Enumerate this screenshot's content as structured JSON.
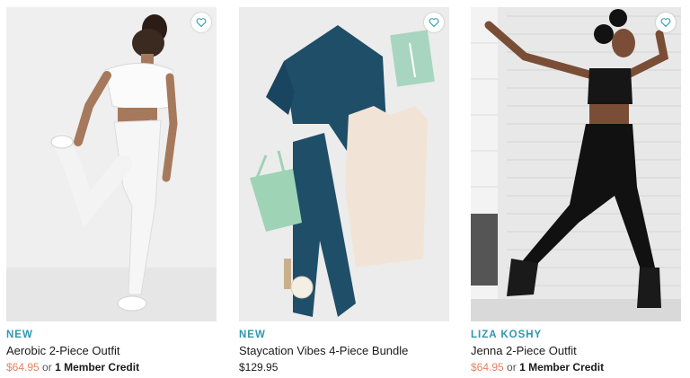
{
  "products": [
    {
      "badge": "NEW",
      "name": "Aerobic 2-Piece Outfit",
      "price": "$64.95",
      "price_color": "#e8825e",
      "or_text": "or",
      "credit_text": "1 Member Credit",
      "favorite_icon": "heart-outline-icon"
    },
    {
      "badge": "NEW",
      "name": "Staycation Vibes 4-Piece Bundle",
      "price": "$129.95",
      "price_color": "#1a1a1a",
      "favorite_icon": "heart-outline-icon"
    },
    {
      "badge": "LIZA KOSHY",
      "name": "Jenna 2-Piece Outfit",
      "price": "$64.95",
      "price_color": "#e8825e",
      "or_text": "or",
      "credit_text": "1 Member Credit",
      "favorite_icon": "heart-outline-icon"
    }
  ],
  "colors": {
    "badge": "#2f98ad",
    "sale_price": "#e8825e"
  }
}
